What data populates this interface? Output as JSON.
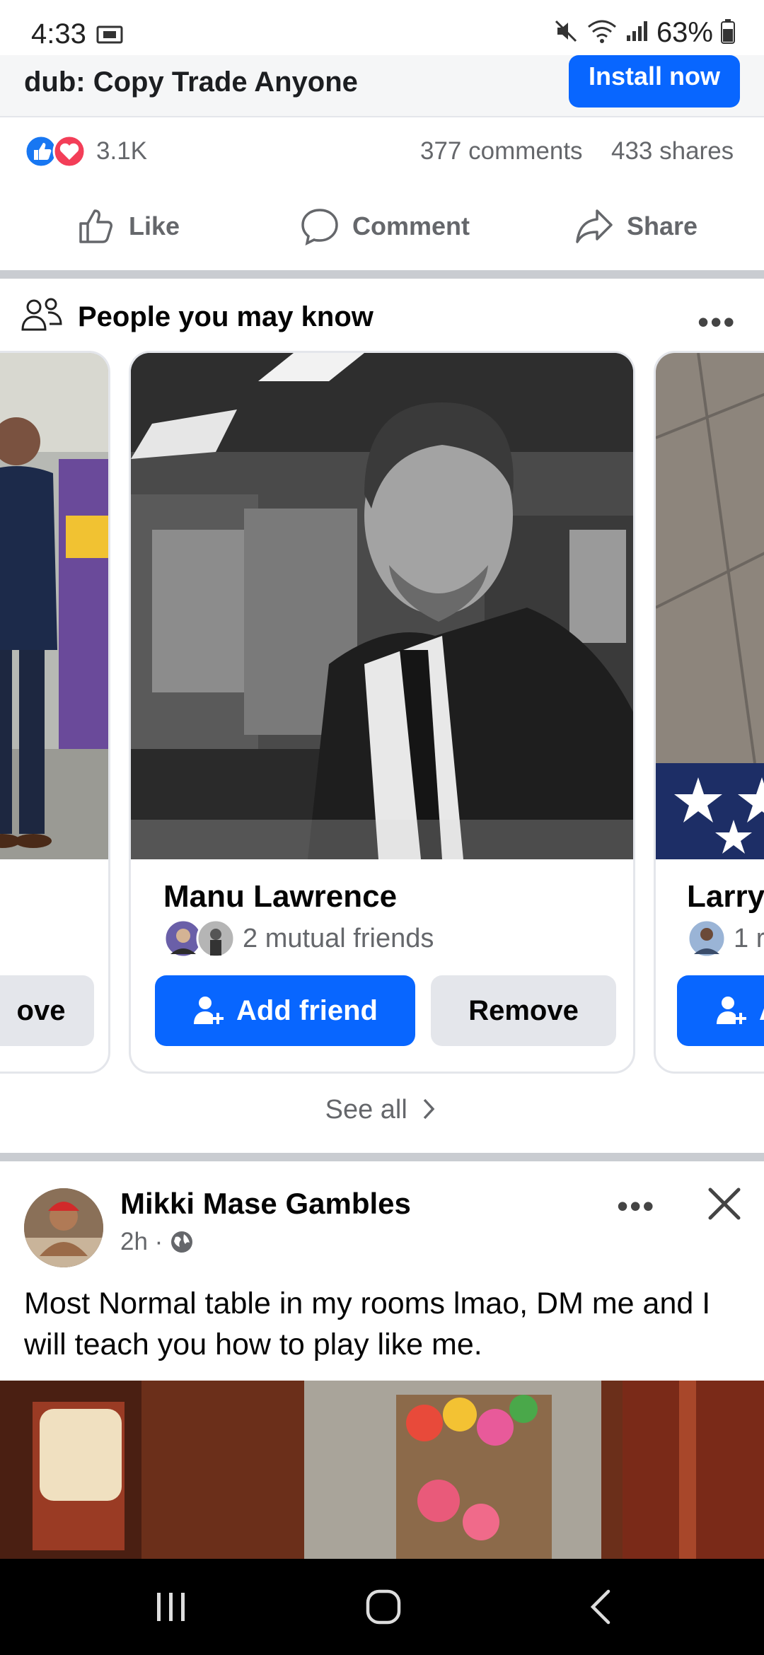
{
  "status_bar": {
    "time": "4:33",
    "battery": "63%",
    "icons": [
      "cast-icon",
      "mute-icon",
      "wifi-6e-icon",
      "signal-icon",
      "battery-icon"
    ]
  },
  "ad": {
    "title": "dub: Copy Trade Anyone",
    "install_label": "Install now"
  },
  "engagement": {
    "reactions_count": "3.1K",
    "comments": "377 comments",
    "shares": "433 shares"
  },
  "actions": {
    "like": "Like",
    "comment": "Comment",
    "share": "Share"
  },
  "pymk": {
    "title": "People you may know",
    "cards": [
      {
        "name": "",
        "mutual": "",
        "remove_label": "ove"
      },
      {
        "name": "Manu Lawrence",
        "mutual": "2 mutual friends",
        "add_label": "Add friend",
        "remove_label": "Remove"
      },
      {
        "name": "Larry",
        "mutual": "1 r",
        "add_label": "A"
      }
    ],
    "see_all": "See all"
  },
  "post": {
    "author": "Mikki Mase Gambles",
    "time": "2h ·",
    "text": "Most Normal table in my rooms lmao, DM me and I will teach you how to play like me."
  },
  "colors": {
    "brand_blue": "#0866ff",
    "secondary_text": "#65676b",
    "separator": "#c9ccd1"
  }
}
